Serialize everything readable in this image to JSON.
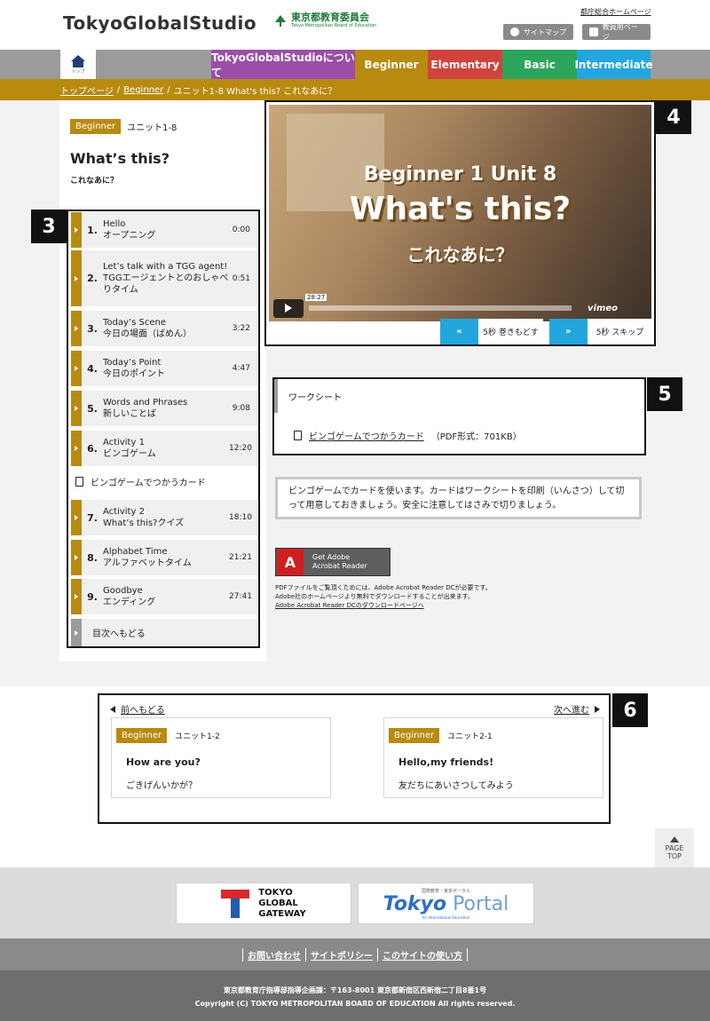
{
  "header": {
    "logo": "TokyoGlobalStudio",
    "board_name": "東京都教育委員会",
    "board_sub": "Tokyo Metropolitan Board of Education",
    "gov_link": "都庁総合ホームページ",
    "sitemap": "サイトマップ",
    "teacher": "教員用ページ"
  },
  "nav": {
    "home_label": "トップ",
    "tabs": [
      "TokyoGlobalStudioについて",
      "Beginner",
      "Elementary",
      "Basic",
      "Intermediate"
    ]
  },
  "breadcrumb": {
    "top": "トップページ",
    "level": "Beginner",
    "current": "ユニット1-8 What's this? これなあに？"
  },
  "unit": {
    "badge": "Beginner",
    "unit_no": "ユニット1-8",
    "title": "What’s this?",
    "subtitle": "これなあに？"
  },
  "markers": [
    "3",
    "4",
    "5",
    "6"
  ],
  "chapters": [
    {
      "num": "1.",
      "en": "Hello",
      "ja": "オープニング",
      "time": "0:00"
    },
    {
      "num": "2.",
      "en": "Let’s talk with a TGG agent!",
      "ja": "TGGエージェントとのおしゃべりタイム",
      "time": "0:51"
    },
    {
      "num": "3.",
      "en": "Today’s Scene",
      "ja": "今日の場面（ばめん）",
      "time": "3:22"
    },
    {
      "num": "4.",
      "en": "Today’s Point",
      "ja": "今日のポイント",
      "time": "4:47"
    },
    {
      "num": "5.",
      "en": "Words and Phrases",
      "ja": "新しいことば",
      "time": "9:08"
    },
    {
      "num": "6.",
      "en": "Activity 1",
      "ja": "ビンゴゲーム",
      "time": "12:20"
    },
    {
      "num": "7.",
      "en": "Activity 2",
      "ja": "What’s this?クイズ",
      "time": "18:10"
    },
    {
      "num": "8.",
      "en": "Alphabet Time",
      "ja": "アルファベットタイム",
      "time": "21:21"
    },
    {
      "num": "9.",
      "en": "Goodbye",
      "ja": "エンディング",
      "time": "27:41"
    }
  ],
  "chapter_worksheet": "ビンゴゲームでつかうカード",
  "back_to_index": "目次へもどる",
  "video": {
    "line1": "Beginner 1 Unit 8",
    "line2": "What's this?",
    "line3": "これなあに？",
    "duration": "28:27",
    "brand": "vimeo",
    "progress": 0.0,
    "rewind_label": "5秒 巻きもどす",
    "skip_label": "5秒 スキップ"
  },
  "worksheet": {
    "heading": "ワークシート",
    "link": "ビンゴゲームでつかうカード",
    "format": "（PDF形式：701KB）"
  },
  "note": "ビンゴゲームでカードを使います。カードはワークシートを印刷（いんさつ）して切って用意しておきましょう。安全に注意してはさみで切りましょう。",
  "adobe": {
    "line1": "Get Adobe",
    "line2": "Acrobat Reader",
    "note1": "PDFファイルをご覧頂くためには、Adobe Acrobat Reader DCが必要です。",
    "note2": "Adobe社のホームページより無料でダウンロードすることが出来ます。",
    "download": "Adobe Acrobat Reader DCのダウンロードページへ"
  },
  "pager": {
    "prev_label": "前へもどる",
    "next_label": "次へ進む",
    "prev": {
      "badge": "Beginner",
      "unit": "ユニット1-2",
      "title": "How are you?",
      "subtitle": "ごきげんいかが？"
    },
    "next": {
      "badge": "Beginner",
      "unit": "ユニット2-1",
      "title": "Hello,my friends!",
      "subtitle": "友だちにあいさつしてみよう"
    }
  },
  "pagetop": {
    "line1": "PAGE",
    "line2": "TOP"
  },
  "footer": {
    "tgg": [
      "TOKYO",
      "GLOBAL",
      "GATEWAY"
    ],
    "portal_small": "国際教育・東京ポータル",
    "portal_big1": "Tokyo",
    "portal_big2": " Portal",
    "portal_sub": "for International Education",
    "links": [
      "お問い合わせ",
      "サイトポリシー",
      "このサイトの使い方"
    ],
    "address": "東京都教育庁指導部指導企画課：〒163-8001 東京都新宿区西新宿二丁目8番1号",
    "copyright": "Copyright (C) TOKYO METROPOLITAN BOARD OF EDUCATION All rights reserved."
  },
  "colors": {
    "beginner": "#b88a10",
    "about": "#9a4ea8",
    "elementary": "#d2423c",
    "basic": "#2aa55a",
    "intermediate": "#23a5de"
  }
}
